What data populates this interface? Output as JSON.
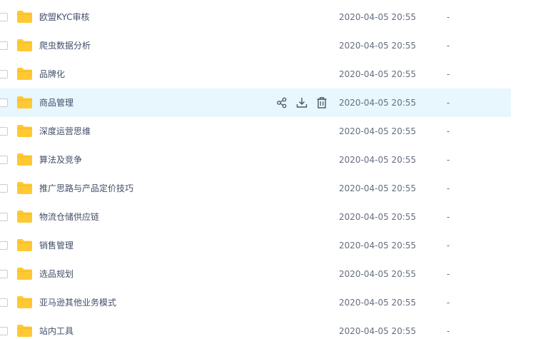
{
  "files": [
    {
      "name": "欧盟KYC审核",
      "date": "2020-04-05 20:55",
      "size": "-"
    },
    {
      "name": "爬虫数据分析",
      "date": "2020-04-05 20:55",
      "size": "-"
    },
    {
      "name": "品牌化",
      "date": "2020-04-05 20:55",
      "size": "-"
    },
    {
      "name": "商品管理",
      "date": "2020-04-05 20:55",
      "size": "-"
    },
    {
      "name": "深度运营思维",
      "date": "2020-04-05 20:55",
      "size": "-"
    },
    {
      "name": "算法及竞争",
      "date": "2020-04-05 20:55",
      "size": "-"
    },
    {
      "name": "推广思路与产品定价技巧",
      "date": "2020-04-05 20:55",
      "size": "-"
    },
    {
      "name": "物流仓储供应链",
      "date": "2020-04-05 20:55",
      "size": "-"
    },
    {
      "name": "销售管理",
      "date": "2020-04-05 20:55",
      "size": "-"
    },
    {
      "name": "选品规划",
      "date": "2020-04-05 20:55",
      "size": "-"
    },
    {
      "name": "亚马逊其他业务模式",
      "date": "2020-04-05 20:55",
      "size": "-"
    },
    {
      "name": "站内工具",
      "date": "2020-04-05 20:55",
      "size": "-"
    }
  ],
  "hovered_index": 3,
  "row_actions": [
    "share-icon",
    "download-icon",
    "delete-icon"
  ],
  "colors": {
    "folder": "#ffc933",
    "hover_bg": "#e8f6fd",
    "text": "#424e67",
    "meta_text": "#666e7f"
  }
}
